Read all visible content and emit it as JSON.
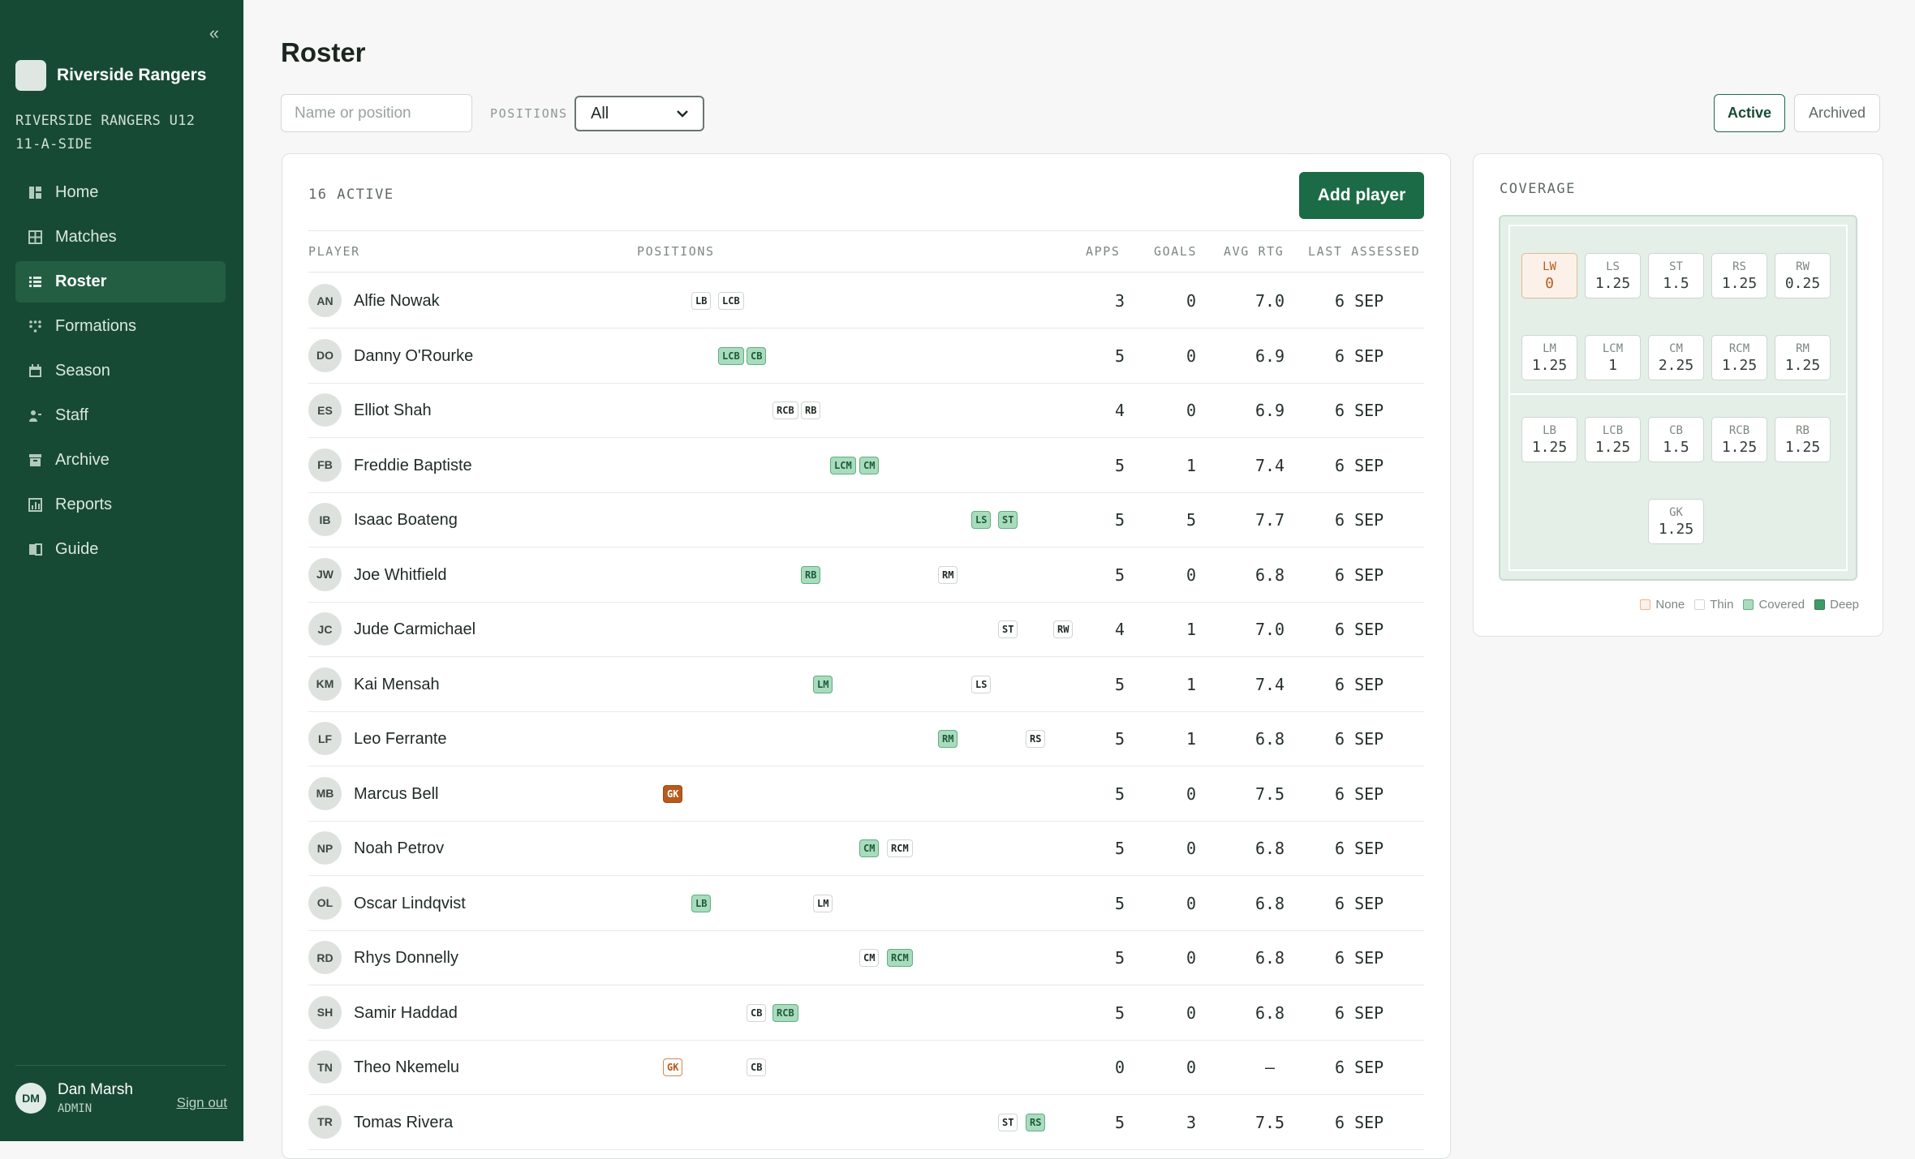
{
  "sidebar": {
    "collapse_glyph": "«",
    "brand": "Riverside Rangers",
    "team_line1": "RIVERSIDE RANGERS U12",
    "team_line2": "11-A-SIDE",
    "nav": [
      {
        "label": "Home",
        "icon": "home-icon",
        "active": false
      },
      {
        "label": "Matches",
        "icon": "matches-icon",
        "active": false
      },
      {
        "label": "Roster",
        "icon": "roster-list-icon",
        "active": true
      },
      {
        "label": "Formations",
        "icon": "formations-icon",
        "active": false
      },
      {
        "label": "Season",
        "icon": "calendar-icon",
        "active": false
      },
      {
        "label": "Staff",
        "icon": "staff-icon",
        "active": false
      },
      {
        "label": "Archive",
        "icon": "archive-icon",
        "active": false
      },
      {
        "label": "Reports",
        "icon": "reports-icon",
        "active": false
      },
      {
        "label": "Guide",
        "icon": "guide-icon",
        "active": false
      }
    ],
    "user": {
      "initials": "DM",
      "name": "Dan Marsh",
      "role": "ADMIN",
      "signout": "Sign out"
    }
  },
  "header": {
    "title": "Roster"
  },
  "filters": {
    "search_placeholder": "Name or position",
    "positions_label": "POSITIONS",
    "positions_value": "All",
    "toggle_active": "Active",
    "toggle_archived": "Archived"
  },
  "roster": {
    "count": "16 ACTIVE",
    "add_button": "Add player",
    "columns": {
      "player": "PLAYER",
      "positions": "POSITIONS",
      "apps": "APPS",
      "goals": "GOALS",
      "avg": "AVG RTG",
      "last": "LAST ASSESSED"
    },
    "players": [
      {
        "initials": "AN",
        "name": "Alfie Nowak",
        "positions": [
          "LB",
          "LCB"
        ],
        "primary": [],
        "apps": "3",
        "goals": "0",
        "avg": "7.0",
        "last": "6 SEP"
      },
      {
        "initials": "DO",
        "name": "Danny O'Rourke",
        "positions": [
          "LCB",
          "CB"
        ],
        "primary": [
          "LCB",
          "CB"
        ],
        "apps": "5",
        "goals": "0",
        "avg": "6.9",
        "last": "6 SEP"
      },
      {
        "initials": "ES",
        "name": "Elliot Shah",
        "positions": [
          "RCB",
          "RB"
        ],
        "primary": [],
        "apps": "4",
        "goals": "0",
        "avg": "6.9",
        "last": "6 SEP"
      },
      {
        "initials": "FB",
        "name": "Freddie Baptiste",
        "positions": [
          "LCM",
          "CM"
        ],
        "primary": [
          "LCM",
          "CM"
        ],
        "apps": "5",
        "goals": "1",
        "avg": "7.4",
        "last": "6 SEP"
      },
      {
        "initials": "IB",
        "name": "Isaac Boateng",
        "positions": [
          "LS",
          "ST"
        ],
        "primary": [
          "LS",
          "ST"
        ],
        "apps": "5",
        "goals": "5",
        "avg": "7.7",
        "last": "6 SEP"
      },
      {
        "initials": "JW",
        "name": "Joe Whitfield",
        "positions": [
          "RB",
          "RM"
        ],
        "primary": [
          "RB"
        ],
        "apps": "5",
        "goals": "0",
        "avg": "6.8",
        "last": "6 SEP"
      },
      {
        "initials": "JC",
        "name": "Jude Carmichael",
        "positions": [
          "ST",
          "RW"
        ],
        "primary": [],
        "apps": "4",
        "goals": "1",
        "avg": "7.0",
        "last": "6 SEP"
      },
      {
        "initials": "KM",
        "name": "Kai Mensah",
        "positions": [
          "LM",
          "LS"
        ],
        "primary": [
          "LM"
        ],
        "apps": "5",
        "goals": "1",
        "avg": "7.4",
        "last": "6 SEP"
      },
      {
        "initials": "LF",
        "name": "Leo Ferrante",
        "positions": [
          "RM",
          "RS"
        ],
        "primary": [
          "RM"
        ],
        "apps": "5",
        "goals": "1",
        "avg": "6.8",
        "last": "6 SEP"
      },
      {
        "initials": "MB",
        "name": "Marcus Bell",
        "positions": [
          "GK"
        ],
        "primary": [
          "GK"
        ],
        "apps": "5",
        "goals": "0",
        "avg": "7.5",
        "last": "6 SEP"
      },
      {
        "initials": "NP",
        "name": "Noah Petrov",
        "positions": [
          "CM",
          "RCM"
        ],
        "primary": [
          "CM"
        ],
        "apps": "5",
        "goals": "0",
        "avg": "6.8",
        "last": "6 SEP"
      },
      {
        "initials": "OL",
        "name": "Oscar Lindqvist",
        "positions": [
          "LB",
          "LM"
        ],
        "primary": [
          "LB"
        ],
        "apps": "5",
        "goals": "0",
        "avg": "6.8",
        "last": "6 SEP"
      },
      {
        "initials": "RD",
        "name": "Rhys Donnelly",
        "positions": [
          "CM",
          "RCM"
        ],
        "primary": [
          "RCM"
        ],
        "apps": "5",
        "goals": "0",
        "avg": "6.8",
        "last": "6 SEP"
      },
      {
        "initials": "SH",
        "name": "Samir Haddad",
        "positions": [
          "CB",
          "RCB"
        ],
        "primary": [
          "RCB"
        ],
        "apps": "5",
        "goals": "0",
        "avg": "6.8",
        "last": "6 SEP"
      },
      {
        "initials": "TN",
        "name": "Theo Nkemelu",
        "positions": [
          "GK",
          "CB"
        ],
        "primary": [],
        "apps": "0",
        "goals": "0",
        "avg": "–",
        "last": "6 SEP"
      },
      {
        "initials": "TR",
        "name": "Tomas Rivera",
        "positions": [
          "ST",
          "RS"
        ],
        "primary": [
          "RS"
        ],
        "apps": "5",
        "goals": "3",
        "avg": "7.5",
        "last": "6 SEP"
      }
    ]
  },
  "coverage": {
    "title": "COVERAGE",
    "cells": [
      {
        "pos": "LW",
        "value": "0",
        "level": "none"
      },
      {
        "pos": "LS",
        "value": "1.25"
      },
      {
        "pos": "ST",
        "value": "1.5"
      },
      {
        "pos": "RS",
        "value": "1.25"
      },
      {
        "pos": "RW",
        "value": "0.25"
      },
      {
        "pos": "LM",
        "value": "1.25"
      },
      {
        "pos": "LCM",
        "value": "1"
      },
      {
        "pos": "CM",
        "value": "2.25"
      },
      {
        "pos": "RCM",
        "value": "1.25"
      },
      {
        "pos": "RM",
        "value": "1.25"
      },
      {
        "pos": "LB",
        "value": "1.25"
      },
      {
        "pos": "LCB",
        "value": "1.25"
      },
      {
        "pos": "CB",
        "value": "1.5"
      },
      {
        "pos": "RCB",
        "value": "1.25"
      },
      {
        "pos": "RB",
        "value": "1.25"
      },
      {
        "pos": "GK",
        "value": "1.25"
      }
    ],
    "legend": [
      {
        "label": "None",
        "color": "#fcf1e9"
      },
      {
        "label": "Thin",
        "color": "#ffffff"
      },
      {
        "label": "Covered",
        "color": "#a9dcbd"
      },
      {
        "label": "Deep",
        "color": "#3f9a6a"
      }
    ]
  }
}
